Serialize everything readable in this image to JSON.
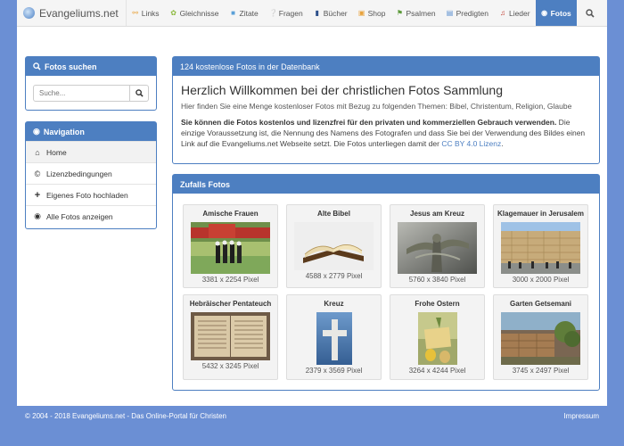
{
  "nav": {
    "brand": "Evangeliums.net",
    "items": [
      {
        "label": "Links",
        "icon": "link-icon"
      },
      {
        "label": "Gleichnisse",
        "icon": "leaf-icon"
      },
      {
        "label": "Zitate",
        "icon": "comment-icon"
      },
      {
        "label": "Fragen",
        "icon": "question-icon"
      },
      {
        "label": "Bücher",
        "icon": "book-icon"
      },
      {
        "label": "Shop",
        "icon": "cart-icon"
      },
      {
        "label": "Psalmen",
        "icon": "bookmark-icon"
      },
      {
        "label": "Predigten",
        "icon": "file-icon"
      },
      {
        "label": "Lieder",
        "icon": "music-icon"
      },
      {
        "label": "Fotos",
        "icon": "camera-icon",
        "active": true
      }
    ]
  },
  "search": {
    "title": "Fotos suchen",
    "placeholder": "Suche..."
  },
  "sidebar": {
    "title": "Navigation",
    "items": [
      {
        "label": "Home",
        "icon": "home-icon"
      },
      {
        "label": "Lizenzbedingungen",
        "icon": "copyright-icon"
      },
      {
        "label": "Eigenes Foto hochladen",
        "icon": "plus-icon"
      },
      {
        "label": "Alle Fotos anzeigen",
        "icon": "camera-icon"
      }
    ]
  },
  "welcome": {
    "header": "124 kostenlose Fotos in der Datenbank",
    "title": "Herzlich Willkommen bei der christlichen Fotos Sammlung",
    "subtitle": "Hier finden Sie eine Menge kostenloser Fotos mit Bezug zu folgenden Themen: Bibel, Christentum, Religion, Glaube",
    "bold_text": "Sie können die Fotos kostenlos und lizenzfrei für den privaten und kommerziellen Gebrauch verwenden.",
    "text": " Die einzige Voraussetzung ist, die Nennung des Namens des Fotografen und dass Sie bei der Verwendung des Bildes einen Link auf die Evangeliums.net Webseite setzt. Die Fotos unterliegen damit der ",
    "license_link": "CC BY 4.0 Lizenz",
    "after_link": "."
  },
  "photos": {
    "header": "Zufalls Fotos",
    "items": [
      {
        "title": "Amische Frauen",
        "size": "3381 x 2254 Pixel"
      },
      {
        "title": "Alte Bibel",
        "size": "4588 x 2779 Pixel"
      },
      {
        "title": "Jesus am Kreuz",
        "size": "5760 x 3840 Pixel"
      },
      {
        "title": "Klagemauer in Jerusalem",
        "size": "3000 x 2000 Pixel"
      },
      {
        "title": "Hebräischer Pentateuch",
        "size": "5432 x 3245 Pixel"
      },
      {
        "title": "Kreuz",
        "size": "2379 x 3569 Pixel"
      },
      {
        "title": "Frohe Ostern",
        "size": "3264 x 4244 Pixel"
      },
      {
        "title": "Garten Getsemani",
        "size": "3745 x 2497 Pixel"
      }
    ]
  },
  "footer": {
    "left": "© 2004 - 2018 Evangeliums.net - Das Online-Portal für Christen",
    "right": "Impressum"
  },
  "colors": {
    "accent": "#4d7fc1",
    "background": "#6b8fd4"
  }
}
